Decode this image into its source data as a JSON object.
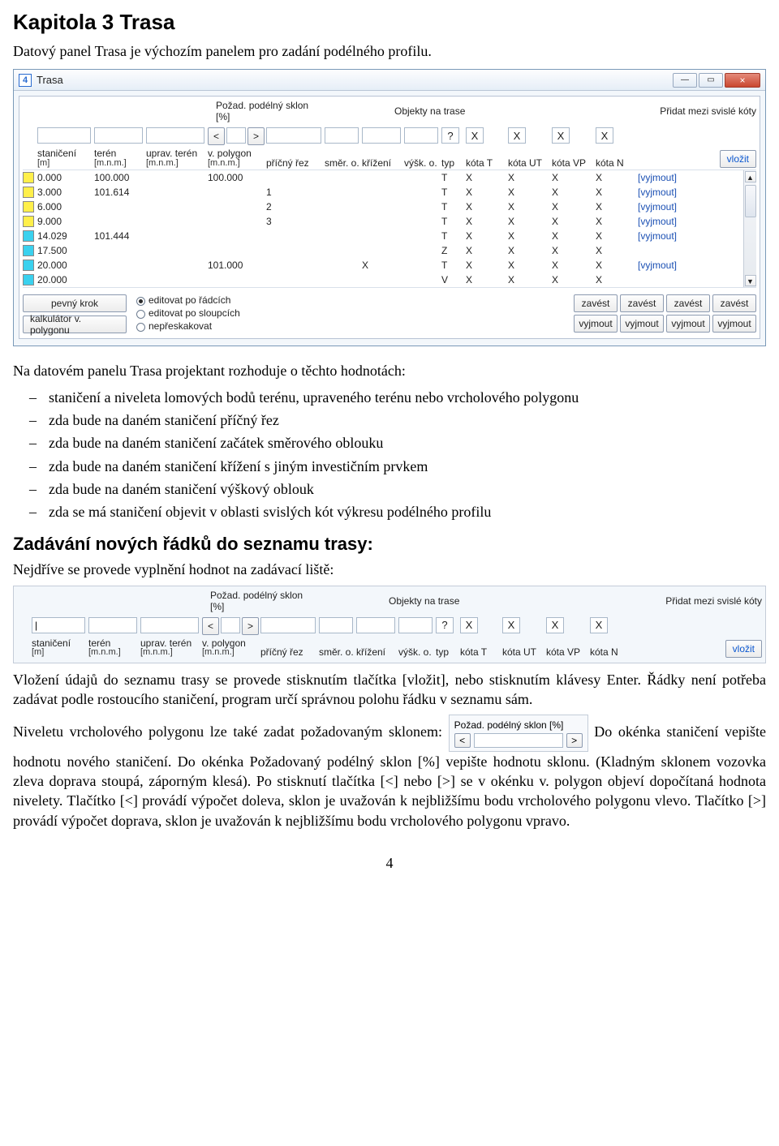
{
  "doc": {
    "chapter_title": "Kapitola 3  Trasa",
    "intro": "Datový panel Trasa je výchozím panelem pro zadání podélného profilu.",
    "after_screenshot_intro": "Na datovém panelu Trasa projektant rozhoduje o těchto hodnotách:",
    "bullets": [
      "staničení a niveleta lomových bodů terénu, upraveného terénu nebo vrcholového polygonu",
      "zda bude na daném staničení příčný řez",
      "zda bude na daném staničení začátek směrového oblouku",
      "zda bude na daném staničení křížení s jiným investičním prvkem",
      "zda bude na daném staničení výškový oblouk",
      "zda se má staničení objevit v oblasti svislých kót výkresu podélného profilu"
    ],
    "section2_title": "Zadávání nových řádků do seznamu trasy:",
    "section2_lead": "Nejdříve se provede vyplnění hodnot na zadávací liště:",
    "para_after_strip": "Vložení údajů do seznamu trasy se provede stisknutím tlačítka [vložit], nebo stisknutím klávesy Enter. Řádky není potřeba zadávat podle rostoucího staničení, program určí správnou polohu řádku v seznamu sám.",
    "para_sklon_before": "Niveletu vrcholového polygonu lze také zadat požadovaným sklonem: ",
    "para_sklon_after": " Do okénka staničení vepište hodnotu nového staničení. Do okénka Požadovaný podélný sklon [%] vepište hodnotu sklonu. (Kladným sklonem vozovka zleva doprava stoupá, záporným klesá). Po stisknutí tlačítka [<] nebo [>] se v okénku v. polygon objeví dopočítaná hodnota nivelety. Tlačítko [<] provádí výpočet doleva, sklon je uvažován k nejbližšímu bodu vrcholového polygonu vlevo. Tlačítko [>] provádí výpočet doprava, sklon je uvažován k nejbližšímu bodu vrcholového polygonu vpravo.",
    "page_number": "4"
  },
  "win": {
    "icon_text": "4",
    "title": "Trasa",
    "min": "—",
    "max": "▭",
    "close": "×"
  },
  "labels": {
    "sklon_label": "Požad. podélný sklon [%]",
    "objekty_label": "Objekty na trase",
    "pridat_label": "Přidat mezi svislé kóty",
    "nav_prev": "<",
    "nav_next": ">",
    "q": "?",
    "insert": "vložit",
    "remove": "[vyjmout]",
    "pevny_krok": "pevný krok",
    "kalk": "kalkulátor v. polygonu",
    "r1": "editovat po řádcích",
    "r2": "editovat po sloupcích",
    "r3": "nepřeskakovat",
    "zavest": "zavést",
    "vyjmout_btn": "vyjmout"
  },
  "columns": [
    {
      "t": "staničení",
      "s": "[m]"
    },
    {
      "t": "terén",
      "s": "[m.n.m.]"
    },
    {
      "t": "uprav. terén",
      "s": "[m.n.m.]"
    },
    {
      "t": "v. polygon",
      "s": "[m.n.m.]"
    },
    {
      "t": "příčný řez",
      "s": ""
    },
    {
      "t": "směr. o.",
      "s": ""
    },
    {
      "t": "křížení",
      "s": ""
    },
    {
      "t": "výšk. o.",
      "s": ""
    },
    {
      "t": "typ",
      "s": ""
    },
    {
      "t": "kóta T",
      "s": ""
    },
    {
      "t": "kóta UT",
      "s": ""
    },
    {
      "t": "kóta VP",
      "s": ""
    },
    {
      "t": "kóta N",
      "s": ""
    }
  ],
  "rows": [
    {
      "c": "#ffef4a",
      "stan": "0.000",
      "ter": "100.000",
      "ut": "",
      "vp": "100.000",
      "pr": "",
      "so": "",
      "kr": "",
      "vo": "",
      "typ": "T",
      "kT": "X",
      "kUT": "X",
      "kVP": "X",
      "kN": "X",
      "rm": true
    },
    {
      "c": "#ffef4a",
      "stan": "3.000",
      "ter": "101.614",
      "ut": "",
      "vp": "",
      "pr": "1",
      "so": "",
      "kr": "",
      "vo": "",
      "typ": "T",
      "kT": "X",
      "kUT": "X",
      "kVP": "X",
      "kN": "X",
      "rm": true
    },
    {
      "c": "#ffef4a",
      "stan": "6.000",
      "ter": "",
      "ut": "",
      "vp": "",
      "pr": "2",
      "so": "",
      "kr": "",
      "vo": "",
      "typ": "T",
      "kT": "X",
      "kUT": "X",
      "kVP": "X",
      "kN": "X",
      "rm": true
    },
    {
      "c": "#ffef4a",
      "stan": "9.000",
      "ter": "",
      "ut": "",
      "vp": "",
      "pr": "3",
      "so": "",
      "kr": "",
      "vo": "",
      "typ": "T",
      "kT": "X",
      "kUT": "X",
      "kVP": "X",
      "kN": "X",
      "rm": true
    },
    {
      "c": "#3ad1ee",
      "stan": "14.029",
      "ter": "101.444",
      "ut": "",
      "vp": "",
      "pr": "",
      "so": "",
      "kr": "",
      "vo": "",
      "typ": "T",
      "kT": "X",
      "kUT": "X",
      "kVP": "X",
      "kN": "X",
      "rm": true
    },
    {
      "c": "#3ad1ee",
      "stan": "17.500",
      "ter": "",
      "ut": "",
      "vp": "",
      "pr": "",
      "so": "",
      "kr": "",
      "vo": "",
      "typ": "Z",
      "kT": "X",
      "kUT": "X",
      "kVP": "X",
      "kN": "X",
      "rm": false
    },
    {
      "c": "#3ad1ee",
      "stan": "20.000",
      "ter": "",
      "ut": "",
      "vp": "101.000",
      "pr": "",
      "so": "",
      "kr": "X",
      "vo": "",
      "typ": "T",
      "kT": "X",
      "kUT": "X",
      "kVP": "X",
      "kN": "X",
      "rm": true
    },
    {
      "c": "#3ad1ee",
      "stan": "20.000",
      "ter": "",
      "ut": "",
      "vp": "",
      "pr": "",
      "so": "",
      "kr": "",
      "vo": "",
      "typ": "V",
      "kT": "X",
      "kUT": "X",
      "kVP": "X",
      "kN": "X",
      "rm": false
    }
  ],
  "chk_defaults": [
    "X",
    "X",
    "X",
    "X"
  ]
}
